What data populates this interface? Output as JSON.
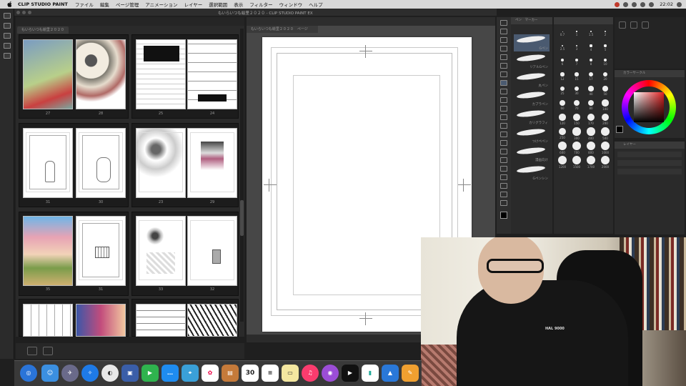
{
  "menubar": {
    "app_name": "CLIP STUDIO PAINT",
    "items": [
      "ファイル",
      "編集",
      "ページ管理",
      "アニメーション",
      "レイヤー",
      "選択範囲",
      "表示",
      "フィルター",
      "ウィンドウ",
      "ヘルプ"
    ],
    "clock": "22:02"
  },
  "window": {
    "title": "もいらいつも絵里２０２０ - CLIP STUDIO PAINT EX"
  },
  "page_manager": {
    "tab_label": "もいらいつも絵里２０２０",
    "page_numbers": [
      "27",
      "28",
      "25",
      "24",
      "31",
      "30",
      "23",
      "29",
      "35",
      "31",
      "33",
      "32"
    ]
  },
  "canvas": {
    "tab_label": "もいらいつも絵里２０２０　ページ"
  },
  "subtool": {
    "tabs": [
      "ペン",
      "マーカー"
    ],
    "brushes": [
      "Gペン",
      "リアルGペン",
      "丸ペン",
      "カブラペン",
      "カリグラフィ",
      "つけぺペン",
      "漫画向け",
      "Gペンシン"
    ]
  },
  "brush_sizes": [
    "0.7",
    "1",
    "1.5",
    "2",
    "2.5",
    "3",
    "4",
    "5",
    "6",
    "7",
    "8",
    "10",
    "12",
    "15",
    "17",
    "20",
    "25",
    "30",
    "40",
    "50",
    "60",
    "70",
    "80",
    "100",
    "120",
    "150",
    "170",
    "200",
    "250",
    "300",
    "400",
    "500",
    "600",
    "700",
    "800",
    "1000",
    "1200",
    "1500",
    "1700",
    "2000"
  ],
  "color_panel": {
    "title": "カラーサークル",
    "main_color": "#000000"
  },
  "layer_panel": {
    "title": "レイヤー"
  },
  "webcam": {
    "shirt_text": "HAL 9000"
  },
  "dock": {
    "calendar_day": "30"
  }
}
